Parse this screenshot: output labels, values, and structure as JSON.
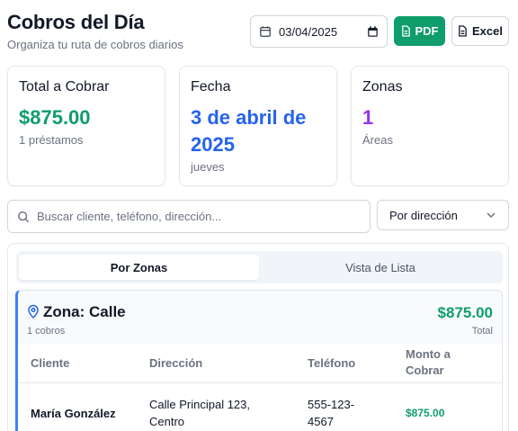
{
  "header": {
    "title": "Cobros del Día",
    "subtitle": "Organiza tu ruta de cobros diarios"
  },
  "toolbar": {
    "date_value": "03/04/2025",
    "pdf_label": "PDF",
    "excel_label": "Excel"
  },
  "cards": [
    {
      "title": "Total a Cobrar",
      "value": "$875.00",
      "sub": "1 préstamos",
      "color": "#0f9d6b"
    },
    {
      "title": "Fecha",
      "value": "3 de abril de 2025",
      "sub": "jueves",
      "color": "#2563eb"
    },
    {
      "title": "Zonas",
      "value": "1",
      "sub": "Áreas",
      "color": "#9333ea"
    }
  ],
  "search": {
    "placeholder": "Buscar cliente, teléfono, dirección..."
  },
  "sort": {
    "selected": "Por dirección"
  },
  "tabs": [
    {
      "label": "Por Zonas",
      "active": true
    },
    {
      "label": "Vista de Lista",
      "active": false
    }
  ],
  "zone": {
    "name": "Zona: Calle",
    "count": "1 cobros",
    "total": "$875.00",
    "total_label": "Total",
    "columns": [
      "Cliente",
      "Dirección",
      "Teléfono",
      "Monto a Cobrar"
    ],
    "rows": [
      {
        "cliente": "María González",
        "direccion": "Calle Principal 123, Centro",
        "telefono": "555-123-4567",
        "monto": "$875.00"
      }
    ]
  },
  "colors": {
    "accent_green": "#0f9d6b",
    "accent_blue": "#2563eb",
    "accent_purple": "#9333ea",
    "zone_border": "#3b82f6"
  },
  "icons": [
    "calendar-icon",
    "file-icon",
    "search-icon",
    "chevron-down-icon",
    "map-pin-icon"
  ]
}
